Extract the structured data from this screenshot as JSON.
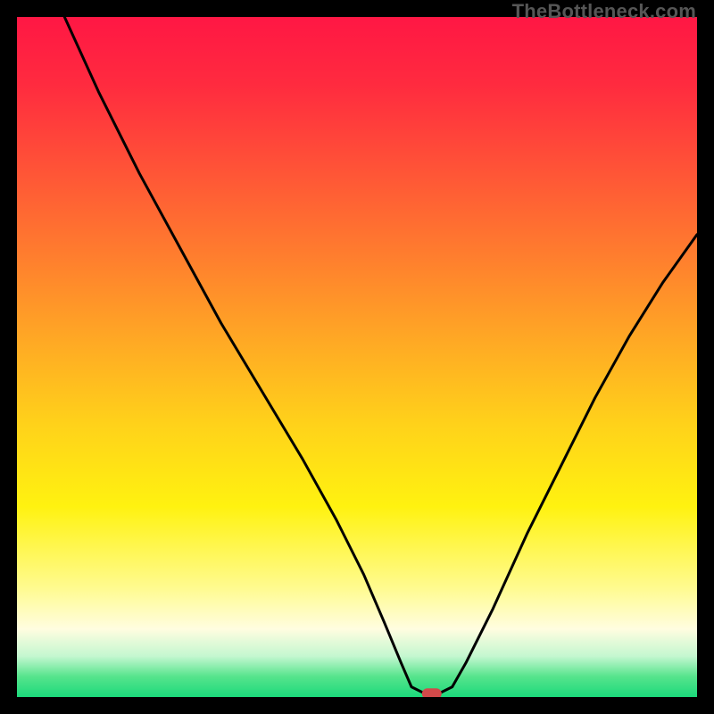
{
  "watermark": "TheBottleneck.com",
  "colors": {
    "background_black": "#000000",
    "curve": "#000000",
    "marker": "#d14a4a",
    "gradient_stops": [
      {
        "offset": 0.0,
        "color": "#ff1744"
      },
      {
        "offset": 0.1,
        "color": "#ff2b3f"
      },
      {
        "offset": 0.22,
        "color": "#ff5237"
      },
      {
        "offset": 0.35,
        "color": "#ff7d2e"
      },
      {
        "offset": 0.48,
        "color": "#ffaa24"
      },
      {
        "offset": 0.6,
        "color": "#ffd21a"
      },
      {
        "offset": 0.72,
        "color": "#fff210"
      },
      {
        "offset": 0.84,
        "color": "#fffb90"
      },
      {
        "offset": 0.9,
        "color": "#fffde0"
      },
      {
        "offset": 0.94,
        "color": "#c4f7d0"
      },
      {
        "offset": 0.97,
        "color": "#56e48c"
      },
      {
        "offset": 1.0,
        "color": "#1bd97b"
      }
    ]
  },
  "chart_data": {
    "type": "line",
    "title": "",
    "xlabel": "",
    "ylabel": "",
    "xlim": [
      0,
      100
    ],
    "ylim": [
      0,
      100
    ],
    "curve": [
      {
        "x": 7.0,
        "y": 100.0
      },
      {
        "x": 12.0,
        "y": 89.0
      },
      {
        "x": 18.0,
        "y": 77.0
      },
      {
        "x": 24.0,
        "y": 66.0
      },
      {
        "x": 30.0,
        "y": 55.0
      },
      {
        "x": 36.0,
        "y": 45.0
      },
      {
        "x": 42.0,
        "y": 35.0
      },
      {
        "x": 47.0,
        "y": 26.0
      },
      {
        "x": 51.0,
        "y": 18.0
      },
      {
        "x": 54.0,
        "y": 11.0
      },
      {
        "x": 56.5,
        "y": 5.0
      },
      {
        "x": 58.0,
        "y": 1.5
      },
      {
        "x": 60.0,
        "y": 0.5
      },
      {
        "x": 62.0,
        "y": 0.5
      },
      {
        "x": 64.0,
        "y": 1.5
      },
      {
        "x": 66.0,
        "y": 5.0
      },
      {
        "x": 70.0,
        "y": 13.0
      },
      {
        "x": 75.0,
        "y": 24.0
      },
      {
        "x": 80.0,
        "y": 34.0
      },
      {
        "x": 85.0,
        "y": 44.0
      },
      {
        "x": 90.0,
        "y": 53.0
      },
      {
        "x": 95.0,
        "y": 61.0
      },
      {
        "x": 100.0,
        "y": 68.0
      }
    ],
    "marker": {
      "x": 61.0,
      "y": 0.5
    }
  }
}
